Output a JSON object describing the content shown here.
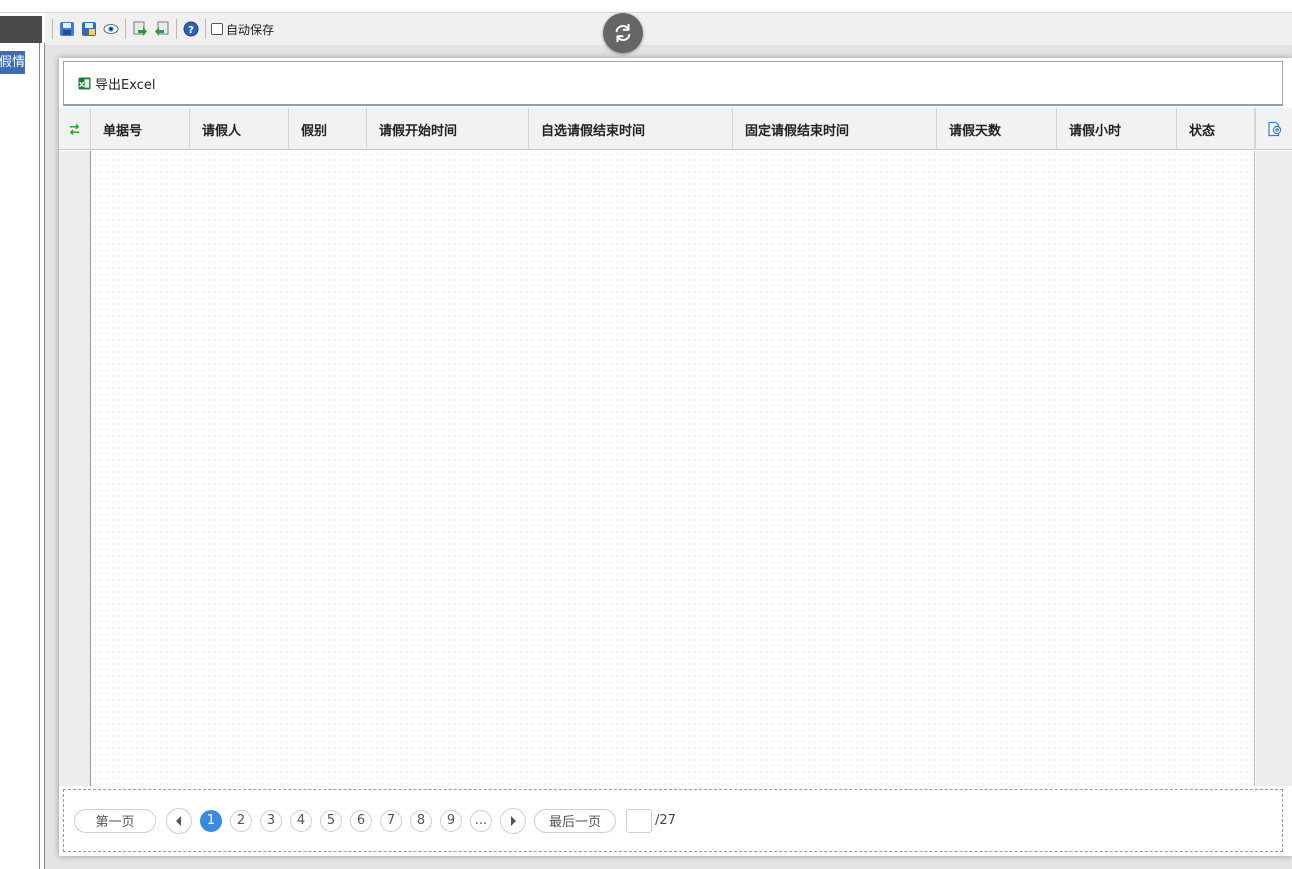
{
  "left_panel": {
    "item_label": "假情"
  },
  "toolbar": {
    "autosave_label": "自动保存",
    "autosave_checked": false,
    "buttons": [
      "save-icon",
      "save-as-icon",
      "preview-icon",
      "import-icon",
      "export-icon",
      "help-icon"
    ]
  },
  "export": {
    "label": "导出Excel"
  },
  "grid": {
    "columns": [
      {
        "label": "单据号"
      },
      {
        "label": "请假人"
      },
      {
        "label": "假别"
      },
      {
        "label": "请假开始时间"
      },
      {
        "label": "自选请假结束时间"
      },
      {
        "label": "固定请假结束时间"
      },
      {
        "label": "请假天数"
      },
      {
        "label": "请假小时"
      },
      {
        "label": "状态"
      }
    ],
    "rows": []
  },
  "pager": {
    "first_label": "第一页",
    "last_label": "最后一页",
    "pages": [
      "1",
      "2",
      "3",
      "4",
      "5",
      "6",
      "7",
      "8",
      "9",
      "..."
    ],
    "current_page": "1",
    "current_input": "",
    "total": "/27"
  },
  "colors": {
    "accent": "#3b89e3",
    "selection": "#3b6db5",
    "excel_green": "#1e7e34"
  }
}
